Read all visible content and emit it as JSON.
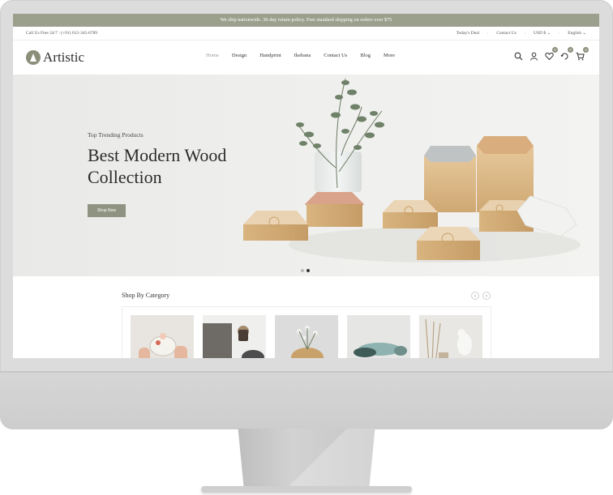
{
  "announcement": "We ship nationwide. 30-day return policy. Free standard shipping on orders over $75",
  "info": {
    "phone": "Call Us Free 24/7 : (+91) 012-345-6789",
    "links": [
      "Today's Deal",
      "Contact Us",
      "USD $",
      "English"
    ]
  },
  "brand": {
    "name": "Artistic"
  },
  "nav": [
    "Home",
    "Design",
    "Handprint",
    "Ikebana",
    "Contact Us",
    "Blog",
    "More"
  ],
  "badges": {
    "compare": "0",
    "wishlist": "0",
    "cart": "0"
  },
  "hero": {
    "subtitle": "Top Trending Products",
    "title": "Best Modern Wood Collection",
    "button": "Shop Now",
    "slides_total": 2,
    "slide_active": 2
  },
  "category": {
    "title": "Shop By Category",
    "prev_arrow": "‹",
    "next_arrow": "›"
  },
  "colors": {
    "accent": "#9ba08c",
    "button": "#8e9481",
    "text": "#2b2b2b"
  }
}
